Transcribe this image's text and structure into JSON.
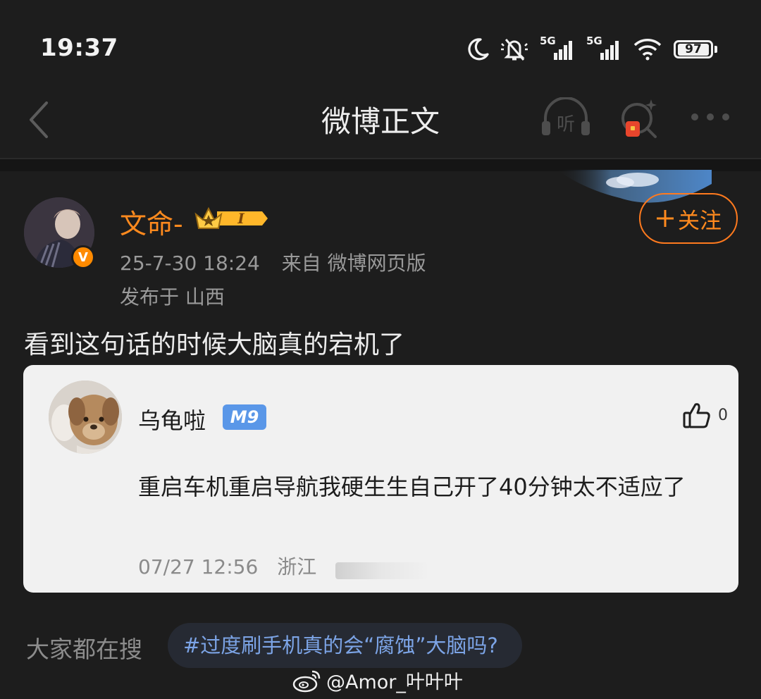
{
  "status_bar": {
    "time": "19:37",
    "network_1": "5G",
    "network_2": "5G",
    "battery": "97"
  },
  "nav": {
    "title": "微博正文",
    "listen_label": "听"
  },
  "post": {
    "author": "文命-",
    "level_badge": "I",
    "verify_mark": "V",
    "timestamp": "25-7-30 18:24",
    "source": "来自 微博网页版",
    "location": "发布于 山西",
    "text": "看到这句话的时候大脑真的宕机了",
    "follow_label": "关注"
  },
  "quote": {
    "author": "乌龟啦",
    "badge": "M9",
    "like_count": "0",
    "text": "重启车机重启导航我硬生生自己开了40分钟太不适应了",
    "date": "07/27 12:56",
    "location": "浙江"
  },
  "search": {
    "label": "大家都在搜",
    "topic": "#过度刷手机真的会“腐蚀”大脑吗?"
  },
  "watermark": "@Amor_叶叶叶",
  "colors": {
    "background": "#1d1d1d",
    "accent_orange": "#ff8a1e",
    "topic_blue": "#7ca4e6",
    "card_bg": "#f1f1f1"
  }
}
